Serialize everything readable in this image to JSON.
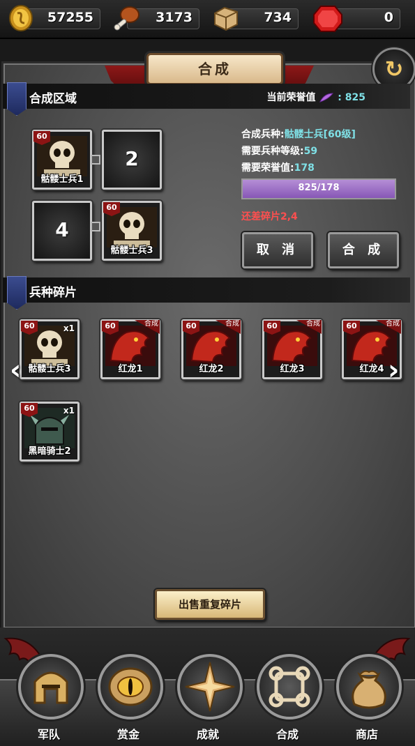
{
  "resources": {
    "gold": "57255",
    "meat": "3173",
    "stone": "734",
    "gem": "0"
  },
  "header": {
    "title": "合成"
  },
  "synth_area": {
    "title": "合成区域",
    "honor_label": "当前荣誉值",
    "honor_value": ": 825",
    "slots": [
      {
        "level": "60",
        "name": "骷髅士兵1",
        "icon": "skeleton-icon"
      },
      {
        "number": "2"
      },
      {
        "number": "4"
      },
      {
        "level": "60",
        "name": "骷髅士兵3",
        "icon": "skeleton-icon"
      }
    ],
    "info": {
      "unit_label": "合成兵种:",
      "unit_value": "骷髅士兵[60级]",
      "level_label": "需要兵种等级:",
      "level_value": "59",
      "honor_label": "需要荣誉值:",
      "honor_value": "178"
    },
    "progress": {
      "text": "825/178",
      "fraction": 1.0
    },
    "missing": "还差碎片2,4",
    "cancel_label": "取 消",
    "confirm_label": "合 成"
  },
  "fragments": {
    "title": "兵种碎片",
    "items": [
      {
        "level": "60",
        "name": "骷髅士兵3",
        "count": "x1",
        "icon": "skeleton-icon"
      },
      {
        "level": "60",
        "name": "红龙1",
        "tag": "合成",
        "icon": "red-dragon-icon"
      },
      {
        "level": "60",
        "name": "红龙2",
        "tag": "合成",
        "icon": "red-dragon-icon"
      },
      {
        "level": "60",
        "name": "红龙3",
        "tag": "合成",
        "icon": "red-dragon-icon"
      },
      {
        "level": "60",
        "name": "红龙4",
        "tag": "合成",
        "icon": "red-dragon-icon"
      },
      {
        "level": "60",
        "name": "黑暗骑士2",
        "count": "x1",
        "icon": "dark-knight-helmet-icon"
      }
    ],
    "sell_label": "出售重复碎片"
  },
  "nav": [
    {
      "label": "军队",
      "icon": "helmet-icon"
    },
    {
      "label": "赏金",
      "icon": "eye-icon"
    },
    {
      "label": "成就",
      "icon": "compass-star-icon"
    },
    {
      "label": "合成",
      "icon": "knot-icon"
    },
    {
      "label": "商店",
      "icon": "money-bag-icon"
    }
  ],
  "colors": {
    "accent_cyan": "#7fe0e6",
    "missing_red": "#ff4f4f",
    "progress_purple": "#8757b6"
  }
}
